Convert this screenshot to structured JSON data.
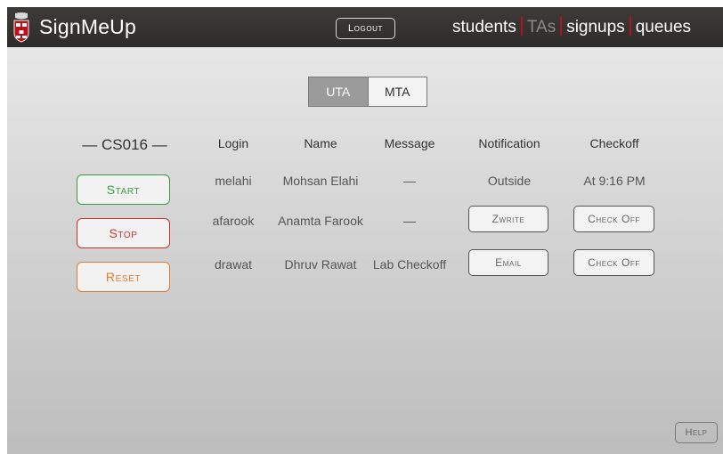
{
  "header": {
    "title": "SignMeUp",
    "logo_icon": "shield-crest-icon",
    "logout_label": "Logout",
    "nav": [
      {
        "label": "students",
        "active": false
      },
      {
        "label": "TAs",
        "active": true
      },
      {
        "label": "signups",
        "active": false
      },
      {
        "label": "queues",
        "active": false
      }
    ]
  },
  "toggle": {
    "options": [
      "UTA",
      "MTA"
    ],
    "selected": "UTA"
  },
  "course": {
    "title": "— CS016 —"
  },
  "controls": {
    "start": "Start",
    "stop": "Stop",
    "reset": "Reset"
  },
  "table": {
    "columns": [
      "Login",
      "Name",
      "Message",
      "Notification",
      "Checkoff"
    ],
    "rows": [
      {
        "login": "melahi",
        "name": "Mohsan Elahi",
        "message": "—",
        "notification": "Outside",
        "checkoff": "At 9:16 PM"
      },
      {
        "login": "afarook",
        "name": "Anamta Farook",
        "message": "—",
        "notification": "Zwrite",
        "checkoff": "Check Off"
      },
      {
        "login": "drawat",
        "name": "Dhruv Rawat",
        "message": "Lab Checkoff",
        "notification": "Email",
        "checkoff": "Check Off"
      }
    ]
  },
  "help_label": "Help",
  "colors": {
    "start": "#3d9a43",
    "stop": "#c8322b",
    "reset": "#e07b2a",
    "nav_separator": "#b5121b",
    "topbar": "#2e2c2a"
  }
}
